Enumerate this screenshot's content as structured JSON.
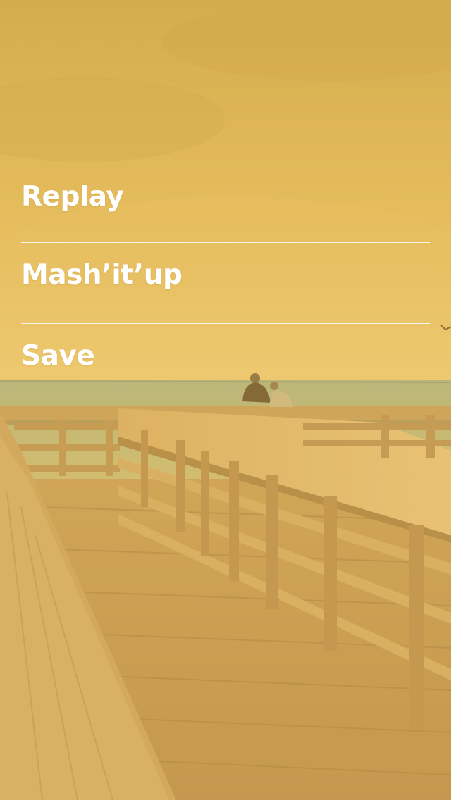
{
  "menu": {
    "items": [
      {
        "label": "Replay"
      },
      {
        "label": "Mash’it’up"
      },
      {
        "label": "Save"
      }
    ]
  },
  "colors": {
    "overlay_tint": "#ecbe50",
    "text": "#ffffff",
    "divider": "#ffffff"
  },
  "background": {
    "scene": "wooden-pier-over-sea-at-sunset"
  }
}
